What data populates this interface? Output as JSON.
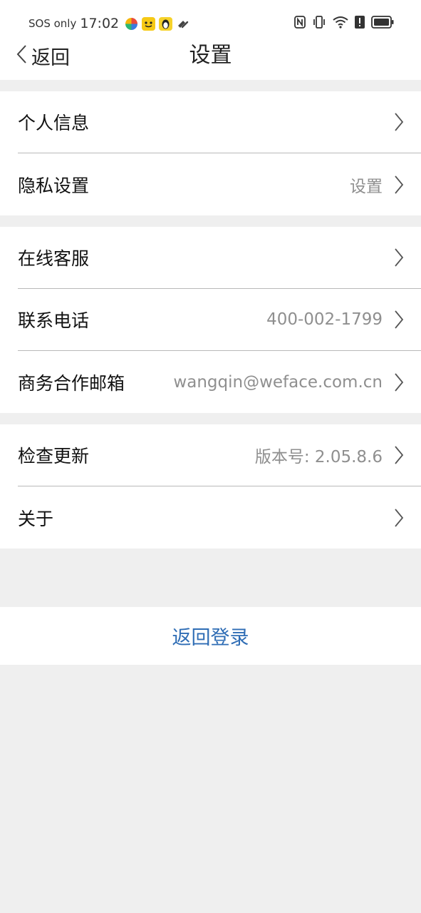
{
  "status_bar": {
    "carrier": "SOS only",
    "time": "17:02",
    "icons": [
      "app-pinwheel-icon",
      "app-yellow-face-icon",
      "app-penguin-icon",
      "app-badge-icon",
      "nfc-icon",
      "vibrate-icon",
      "wifi-icon",
      "alert-icon",
      "battery-icon"
    ]
  },
  "nav": {
    "back_label": "返回",
    "title": "设置"
  },
  "groups": [
    {
      "items": [
        {
          "label": "个人信息",
          "value": ""
        },
        {
          "label": "隐私设置",
          "value": "设置"
        }
      ]
    },
    {
      "items": [
        {
          "label": "在线客服",
          "value": ""
        },
        {
          "label": "联系电话",
          "value": "400-002-1799"
        },
        {
          "label": "商务合作邮箱",
          "value": "wangqin@weface.com.cn"
        }
      ]
    },
    {
      "items": [
        {
          "label": "检查更新",
          "value": "版本号: 2.05.8.6"
        },
        {
          "label": "关于",
          "value": ""
        }
      ]
    }
  ],
  "logout_label": "返回登录",
  "colors": {
    "accent": "#2f6db5",
    "background": "#efefef",
    "divider": "#b9b9b9",
    "value_text": "#8f8f8f"
  }
}
